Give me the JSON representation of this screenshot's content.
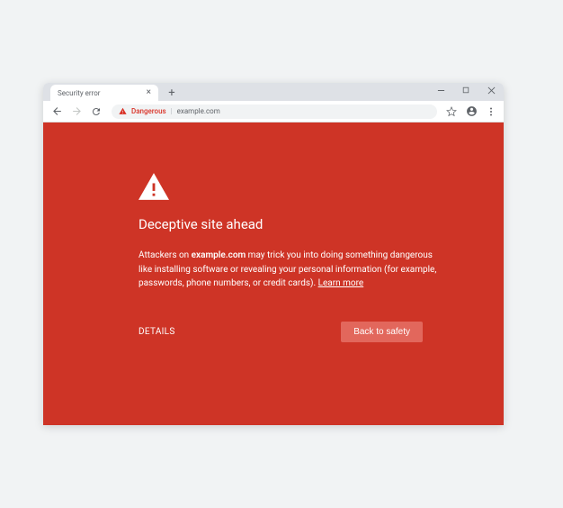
{
  "tab": {
    "title": "Security error"
  },
  "omnibox": {
    "danger_label": "Dangerous",
    "url": "example.com"
  },
  "warning": {
    "heading": "Deceptive site ahead",
    "body_prefix": "Attackers on ",
    "body_domain": "example.com",
    "body_suffix": " may trick you into doing something dangerous like installing software or revealing your personal information (for example, passwords, phone numbers, or credit cards). ",
    "learn_more": "Learn more",
    "details": "DETAILS",
    "back_to_safety": "Back to safety"
  }
}
